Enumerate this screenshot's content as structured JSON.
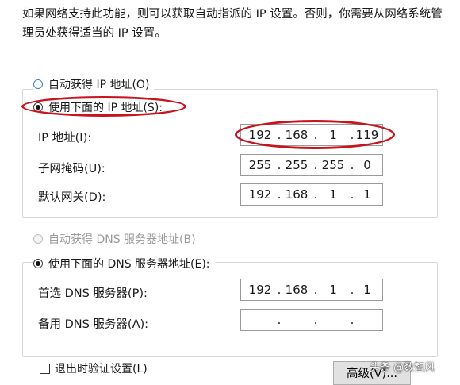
{
  "intro_text": "如果网络支持此功能，则可以获取自动指派的 IP 设置。否则，你需要从网络系统管理员处获得适当的 IP 设置。",
  "ip_section": {
    "auto_ip_label": "自动获得 IP 地址(O)",
    "manual_ip_label": "使用下面的 IP 地址(S):",
    "selected": "manual",
    "fields": [
      {
        "label": "IP 地址(I):",
        "octets": [
          "192",
          "168",
          "1",
          "119"
        ]
      },
      {
        "label": "子网掩码(U):",
        "octets": [
          "255",
          "255",
          "255",
          "0"
        ]
      },
      {
        "label": "默认网关(D):",
        "octets": [
          "192",
          "168",
          "1",
          "1"
        ]
      }
    ]
  },
  "dns_section": {
    "auto_dns_label": "自动获得 DNS 服务器地址(B)",
    "manual_dns_label": "使用下面的 DNS 服务器地址(E):",
    "selected": "manual",
    "fields": [
      {
        "label": "首选 DNS 服务器(P):",
        "octets": [
          "192",
          "168",
          "1",
          "1"
        ]
      },
      {
        "label": "备用 DNS 服务器(A):",
        "octets": [
          "",
          "",
          "",
          ""
        ]
      }
    ]
  },
  "validate_on_exit_label": "退出时验证设置(L)",
  "validate_on_exit_checked": false,
  "advanced_button_label": "高级(V)...",
  "watermark_text": "头条 @数智风",
  "colors": {
    "annotation": "#c8141e",
    "selected_radio_border": "#3f7fc4"
  }
}
